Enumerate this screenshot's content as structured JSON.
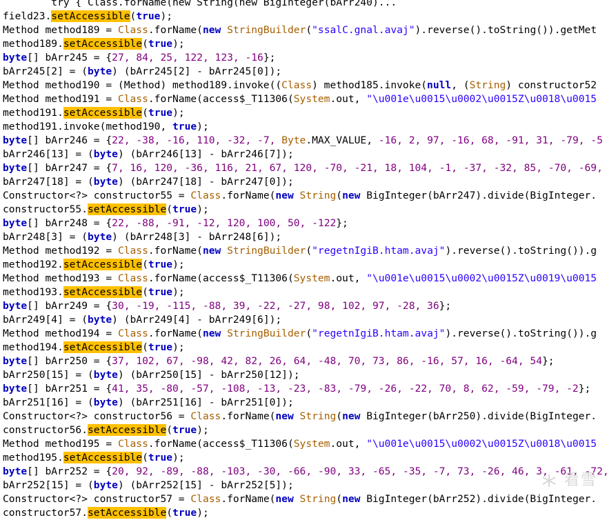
{
  "code_lines": [
    [
      [
        "        try { Class.forName(new String(new BigInteger(bArr240)... ",
        "d"
      ]
    ],
    [
      [
        "field23.",
        "d"
      ],
      [
        "setAccessible",
        "h"
      ],
      [
        "(",
        "d"
      ],
      [
        "true",
        "k"
      ],
      [
        ");",
        "d"
      ]
    ],
    [
      [
        "Method method189 = ",
        "d"
      ],
      [
        "Class",
        "c"
      ],
      [
        ".forName(",
        "d"
      ],
      [
        "new",
        "k"
      ],
      [
        " ",
        "d"
      ],
      [
        "StringBuilder",
        "c"
      ],
      [
        "(",
        "d"
      ],
      [
        "\"ssalC.gnal.avaj\"",
        "s"
      ],
      [
        ").reverse().toString()).getMet",
        "d"
      ]
    ],
    [
      [
        "method189.",
        "d"
      ],
      [
        "setAccessible",
        "h"
      ],
      [
        "(",
        "d"
      ],
      [
        "true",
        "k"
      ],
      [
        ");",
        "d"
      ]
    ],
    [
      [
        "byte",
        "k"
      ],
      [
        "[] bArr245 = {",
        "d"
      ],
      [
        "27, 84, 25, 122, 123, -16",
        "n"
      ],
      [
        "};",
        "d"
      ]
    ],
    [
      [
        "bArr245[2] = (",
        "d"
      ],
      [
        "byte",
        "k"
      ],
      [
        ") (bArr245[2] - bArr245[0]);",
        "d"
      ]
    ],
    [
      [
        "Method method190 = (Method) method189.invoke((",
        "d"
      ],
      [
        "Class",
        "c"
      ],
      [
        ") method185.invoke(",
        "d"
      ],
      [
        "null",
        "k"
      ],
      [
        ", (",
        "d"
      ],
      [
        "String",
        "c"
      ],
      [
        ") constructor52",
        "d"
      ]
    ],
    [
      [
        "Method method191 = ",
        "d"
      ],
      [
        "Class",
        "c"
      ],
      [
        ".forName(access$_T11306(",
        "d"
      ],
      [
        "System",
        "c"
      ],
      [
        ".out, ",
        "d"
      ],
      [
        "\"\\u001e\\u0015\\u0002\\u0015Z\\u0018\\u0015",
        "s"
      ]
    ],
    [
      [
        "method191.",
        "d"
      ],
      [
        "setAccessible",
        "h"
      ],
      [
        "(",
        "d"
      ],
      [
        "true",
        "k"
      ],
      [
        ");",
        "d"
      ]
    ],
    [
      [
        "method191.invoke(method190, ",
        "d"
      ],
      [
        "true",
        "k"
      ],
      [
        ");",
        "d"
      ]
    ],
    [
      [
        "byte",
        "k"
      ],
      [
        "[] bArr246 = {",
        "d"
      ],
      [
        "22, -38, -16, 110, -32, -7, ",
        "n"
      ],
      [
        "Byte",
        "c"
      ],
      [
        ".MAX_VALUE, ",
        "d"
      ],
      [
        "-16, 2, 97, -16, 68, -91, 31, -79, -5",
        "n"
      ]
    ],
    [
      [
        "bArr246[13] = (",
        "d"
      ],
      [
        "byte",
        "k"
      ],
      [
        ") (bArr246[13] - bArr246[7]);",
        "d"
      ]
    ],
    [
      [
        "byte",
        "k"
      ],
      [
        "[] bArr247 = {",
        "d"
      ],
      [
        "7, 16, 120, -36, 116, 21, 67, 120, -70, -21, 18, 104, -1, -37, -32, 85, -70, -69, ",
        "n"
      ]
    ],
    [
      [
        "bArr247[18] = (",
        "d"
      ],
      [
        "byte",
        "k"
      ],
      [
        ") (bArr247[18] - bArr247[0]);",
        "d"
      ]
    ],
    [
      [
        "Constructor<?> constructor55 = ",
        "d"
      ],
      [
        "Class",
        "c"
      ],
      [
        ".forName(",
        "d"
      ],
      [
        "new",
        "k"
      ],
      [
        " ",
        "d"
      ],
      [
        "String",
        "c"
      ],
      [
        "(",
        "d"
      ],
      [
        "new",
        "k"
      ],
      [
        " BigInteger(bArr247).divide(BigInteger.",
        "d"
      ]
    ],
    [
      [
        "constructor55.",
        "d"
      ],
      [
        "setAccessible",
        "h"
      ],
      [
        "(",
        "d"
      ],
      [
        "true",
        "k"
      ],
      [
        ");",
        "d"
      ]
    ],
    [
      [
        "byte",
        "k"
      ],
      [
        "[] bArr248 = {",
        "d"
      ],
      [
        "22, -88, -91, -12, 120, 100, 50, -122",
        "n"
      ],
      [
        "};",
        "d"
      ]
    ],
    [
      [
        "bArr248[3] = (",
        "d"
      ],
      [
        "byte",
        "k"
      ],
      [
        ") (bArr248[3] - bArr248[6]);",
        "d"
      ]
    ],
    [
      [
        "Method method192 = ",
        "d"
      ],
      [
        "Class",
        "c"
      ],
      [
        ".forName(",
        "d"
      ],
      [
        "new",
        "k"
      ],
      [
        " ",
        "d"
      ],
      [
        "StringBuilder",
        "c"
      ],
      [
        "(",
        "d"
      ],
      [
        "\"regetnIgiB.htam.avaj\"",
        "s"
      ],
      [
        ").reverse().toString()).g",
        "d"
      ]
    ],
    [
      [
        "method192.",
        "d"
      ],
      [
        "setAccessible",
        "h"
      ],
      [
        "(",
        "d"
      ],
      [
        "true",
        "k"
      ],
      [
        ");",
        "d"
      ]
    ],
    [
      [
        "Method method193 = ",
        "d"
      ],
      [
        "Class",
        "c"
      ],
      [
        ".forName(access$_T11306(",
        "d"
      ],
      [
        "System",
        "c"
      ],
      [
        ".out, ",
        "d"
      ],
      [
        "\"\\u001e\\u0015\\u0002\\u0015Z\\u0019\\u0015",
        "s"
      ]
    ],
    [
      [
        "method193.",
        "d"
      ],
      [
        "setAccessible",
        "h"
      ],
      [
        "(",
        "d"
      ],
      [
        "true",
        "k"
      ],
      [
        ");",
        "d"
      ]
    ],
    [
      [
        "byte",
        "k"
      ],
      [
        "[] bArr249 = {",
        "d"
      ],
      [
        "30, -19, -115, -88, 39, -22, -27, 98, 102, 97, -28, 36",
        "n"
      ],
      [
        "};",
        "d"
      ]
    ],
    [
      [
        "bArr249[4] = (",
        "d"
      ],
      [
        "byte",
        "k"
      ],
      [
        ") (bArr249[4] - bArr249[6]);",
        "d"
      ]
    ],
    [
      [
        "Method method194 = ",
        "d"
      ],
      [
        "Class",
        "c"
      ],
      [
        ".forName(",
        "d"
      ],
      [
        "new",
        "k"
      ],
      [
        " ",
        "d"
      ],
      [
        "StringBuilder",
        "c"
      ],
      [
        "(",
        "d"
      ],
      [
        "\"regetnIgiB.htam.avaj\"",
        "s"
      ],
      [
        ").reverse().toString()).g",
        "d"
      ]
    ],
    [
      [
        "method194.",
        "d"
      ],
      [
        "setAccessible",
        "h"
      ],
      [
        "(",
        "d"
      ],
      [
        "true",
        "k"
      ],
      [
        ");",
        "d"
      ]
    ],
    [
      [
        "byte",
        "k"
      ],
      [
        "[] bArr250 = {",
        "d"
      ],
      [
        "37, 102, 67, -98, 42, 82, 26, 64, -48, 70, 73, 86, -16, 57, 16, -64, 54",
        "n"
      ],
      [
        "};",
        "d"
      ]
    ],
    [
      [
        "bArr250[15] = (",
        "d"
      ],
      [
        "byte",
        "k"
      ],
      [
        ") (bArr250[15] - bArr250[12]);",
        "d"
      ]
    ],
    [
      [
        "byte",
        "k"
      ],
      [
        "[] bArr251 = {",
        "d"
      ],
      [
        "41, 35, -80, -57, -108, -13, -23, -83, -79, -26, -22, 70, 8, 62, -59, -79, -2",
        "n"
      ],
      [
        "};",
        "d"
      ]
    ],
    [
      [
        "bArr251[16] = (",
        "d"
      ],
      [
        "byte",
        "k"
      ],
      [
        ") (bArr251[16] - bArr251[0]);",
        "d"
      ]
    ],
    [
      [
        "Constructor<?> constructor56 = ",
        "d"
      ],
      [
        "Class",
        "c"
      ],
      [
        ".forName(",
        "d"
      ],
      [
        "new",
        "k"
      ],
      [
        " ",
        "d"
      ],
      [
        "String",
        "c"
      ],
      [
        "(",
        "d"
      ],
      [
        "new",
        "k"
      ],
      [
        " BigInteger(bArr250).divide(BigInteger.",
        "d"
      ]
    ],
    [
      [
        "constructor56.",
        "d"
      ],
      [
        "setAccessible",
        "h"
      ],
      [
        "(",
        "d"
      ],
      [
        "true",
        "k"
      ],
      [
        ");",
        "d"
      ]
    ],
    [
      [
        "Method method195 = ",
        "d"
      ],
      [
        "Class",
        "c"
      ],
      [
        ".forName(access$_T11306(",
        "d"
      ],
      [
        "System",
        "c"
      ],
      [
        ".out, ",
        "d"
      ],
      [
        "\"\\u001e\\u0015\\u0002\\u0015Z\\u0018\\u0015",
        "s"
      ]
    ],
    [
      [
        "method195.",
        "d"
      ],
      [
        "setAccessible",
        "h"
      ],
      [
        "(",
        "d"
      ],
      [
        "true",
        "k"
      ],
      [
        ");",
        "d"
      ]
    ],
    [
      [
        "byte",
        "k"
      ],
      [
        "[] bArr252 = {",
        "d"
      ],
      [
        "20, 92, -89, -88, -103, -30, -66, -90, 33, -65, -35, -7, 73, -26, 46, 3, -61, -72, ",
        "n"
      ]
    ],
    [
      [
        "bArr252[15] = (",
        "d"
      ],
      [
        "byte",
        "k"
      ],
      [
        ") (bArr252[15] - bArr252[5]);",
        "d"
      ]
    ],
    [
      [
        "Constructor<?> constructor57 = ",
        "d"
      ],
      [
        "Class",
        "c"
      ],
      [
        ".forName(",
        "d"
      ],
      [
        "new",
        "k"
      ],
      [
        " ",
        "d"
      ],
      [
        "String",
        "c"
      ],
      [
        "(",
        "d"
      ],
      [
        "new",
        "k"
      ],
      [
        " BigInteger(bArr252).divide(BigInteger.",
        "d"
      ]
    ],
    [
      [
        "constructor57.",
        "d"
      ],
      [
        "setAccessible",
        "h"
      ],
      [
        "(",
        "d"
      ],
      [
        "true",
        "k"
      ],
      [
        ");",
        "d"
      ]
    ]
  ],
  "watermark": "看雪"
}
